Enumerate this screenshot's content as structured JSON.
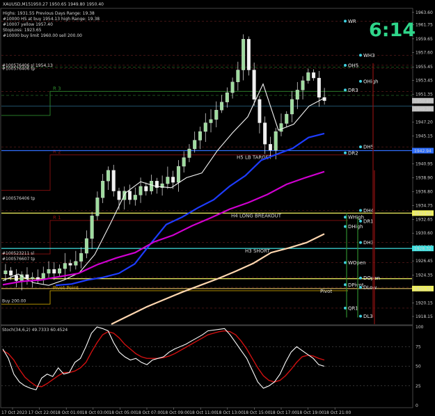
{
  "header": {
    "symbol": "XAUUSD,M15",
    "ohlc": "1950.27 1950.65 1949.80 1950.40",
    "info_lines": [
      "Highs: 1931.55   Previous Days Range: 19.38",
      "#10000 HS at buy 1954.13 high Range: 19.38",
      "#10007 yellow 1957.40",
      "StopLoss: 1923.65",
      "#10000 buy limit 1960.00  sell 200.00"
    ]
  },
  "clock": "6:14",
  "colors": {
    "background": "#000000",
    "candle": "#f0f0f0",
    "ma_fast": "#f5f5f5",
    "ma_blue": "#1e3cff",
    "ma_magenta": "#d000d0",
    "ma_tan": "#ffd7b0",
    "stoch_main": "#ffffff",
    "stoch_signal": "#d01010",
    "yellow_level": "#f0f060",
    "cyan_level": "#40e0e0",
    "blue_level": "#3070ff",
    "dark_red": "#8b1010",
    "green_level": "#2e8b2e"
  },
  "price_axis": {
    "min": 1917,
    "max": 1964,
    "ticks": [
      "1963.60",
      "1961.75",
      "1959.65",
      "1957.60",
      "1955.45",
      "1953.45",
      "1951.35",
      "1949.20",
      "1947.20",
      "1945.15",
      "1942.95",
      "1940.95",
      "1938.90",
      "1936.80",
      "1934.75",
      "1932.65",
      "1930.60",
      "1928.55",
      "1926.45",
      "1924.35",
      "1922.30",
      "1920.15",
      "1918.15"
    ],
    "tags": [
      {
        "text": "1950.40",
        "price": 1950.4,
        "color": "#c0c0c0"
      },
      {
        "text": "1949.20",
        "price": 1949.2,
        "color": "#c0c0c0"
      },
      {
        "text": "1942.94",
        "price": 1942.94,
        "color": "#3070ff"
      },
      {
        "text": "1933.60",
        "price": 1933.6,
        "color": "#f0f060"
      },
      {
        "text": "1928.32",
        "price": 1928.32,
        "color": "#40e0e0"
      },
      {
        "text": "1922.32",
        "price": 1922.32,
        "color": "#f0f060"
      }
    ]
  },
  "time_axis": {
    "labels": [
      "17 Oct 2023",
      "17 Oct 22:00",
      "18 Oct 01:00",
      "18 Oct 03:00",
      "18 Oct 05:00",
      "18 Oct 07:00",
      "18 Oct 09:00",
      "18 Oct 11:00",
      "18 Oct 13:00",
      "18 Oct 15:00",
      "18 Oct 17:00",
      "18 Oct 19:00",
      "18 Oct 21:00"
    ]
  },
  "levels": [
    {
      "label": "R 3",
      "price": 1951.8,
      "color": "#2e8b2e"
    },
    {
      "label": "R 2",
      "price": 1942.3,
      "color": "#8b1010"
    },
    {
      "label": "R 1",
      "price": 1932.5,
      "color": "#8b1010"
    },
    {
      "label": "Pivot Point",
      "price": 1922.0,
      "color": "#c8a000"
    },
    {
      "label": "H5 LB TARGET",
      "price": 1942.3,
      "color": "#d8d8d8"
    },
    {
      "label": "H4 LONG BREAKOUT",
      "price": 1933.6,
      "color": "#d8d8d8"
    },
    {
      "label": "H3 SHORT",
      "price": 1928.32,
      "color": "#d8d8d8"
    },
    {
      "label": "Pivot",
      "price": 1922.3,
      "color": "#d8d8d8"
    }
  ],
  "right_labels": [
    {
      "text": "WR",
      "price": 1962.3
    },
    {
      "text": "WH3",
      "price": 1957.2
    },
    {
      "text": "OH5",
      "price": 1955.7
    },
    {
      "text": "OHigh",
      "price": 1953.3
    },
    {
      "text": "DR3",
      "price": 1952.0
    },
    {
      "text": "DH5",
      "price": 1943.5
    },
    {
      "text": "DR2",
      "price": 1942.6
    },
    {
      "text": "DH4",
      "price": 1934.0
    },
    {
      "text": "WHigh",
      "price": 1933.0
    },
    {
      "text": "DR1",
      "price": 1932.4
    },
    {
      "text": "DHigh",
      "price": 1931.6
    },
    {
      "text": "DH3",
      "price": 1929.2
    },
    {
      "text": "WOpen",
      "price": 1926.2
    },
    {
      "text": "DOpen",
      "price": 1923.9
    },
    {
      "text": "DPivot",
      "price": 1922.9
    },
    {
      "text": "DLow",
      "price": 1922.5
    },
    {
      "text": "QR1",
      "price": 1919.4
    },
    {
      "text": "DL3",
      "price": 1918.2
    }
  ],
  "order_labels": [
    {
      "text": "#100576406 tp",
      "price": 1935.8
    },
    {
      "text": "#100523211 sl",
      "price": 1927.6
    },
    {
      "text": "#100576607 tp",
      "price": 1926.8
    },
    {
      "text": "#100576406 sl  1954.13",
      "price": 1955.7
    },
    {
      "text": "#100576406 tp",
      "price": 1955.2
    },
    {
      "text": "Buy 200.00",
      "price": 1920.5
    }
  ],
  "stochastic": {
    "title": "Stoch(34,6,2) 49.7333 60.4524",
    "ticks": [
      "100",
      "75",
      "50",
      "25",
      "0"
    ],
    "min": 0,
    "max": 100
  },
  "chart_data": {
    "type": "line",
    "title": "XAUUSD,M15",
    "xlabel": "",
    "ylabel": "",
    "ylim": [
      1917,
      1964
    ],
    "candles_close_approx": [
      1925.0,
      1924.3,
      1923.5,
      1924.4,
      1923.8,
      1924.0,
      1923.6,
      1924.6,
      1925.2,
      1924.6,
      1925.3,
      1926.1,
      1925.8,
      1926.4,
      1927.6,
      1929.8,
      1933.2,
      1935.9,
      1938.4,
      1940.0,
      1936.9,
      1935.6,
      1936.9,
      1935.6,
      1936.3,
      1937.6,
      1936.9,
      1938.4,
      1937.4,
      1938.0,
      1939.0,
      1938.2,
      1940.6,
      1941.9,
      1943.2,
      1944.5,
      1945.8,
      1947.1,
      1947.6,
      1949.0,
      1950.2,
      1951.6,
      1953.2,
      1955.0,
      1959.6,
      1955.0,
      1950.6,
      1947.1,
      1943.9,
      1943.0,
      1945.8,
      1947.0,
      1948.4,
      1950.6,
      1952.0,
      1953.4,
      1954.6,
      1953.8,
      1950.9,
      1950.4
    ],
    "series": [
      {
        "name": "",
        "values": [
          1923.5,
          1924.5,
          1923.2,
          1922.8,
          1923.6,
          1924.7,
          1927.4,
          1931.9,
          1936.6,
          1938.3,
          1937.6,
          1937.4,
          1938.9,
          1939.6,
          1942.9,
          1945.6,
          1948.0,
          1952.9,
          1946.0,
          1946.9,
          1949.6,
          1950.8
        ]
      },
      {
        "name": "",
        "values": [
          1922.8,
          1923.0,
          1923.6,
          1924.0,
          1924.6,
          1926.0,
          1929.0,
          1931.9,
          1933.0,
          1934.4,
          1935.6,
          1937.6,
          1939.2,
          1941.5,
          1942.4,
          1943.3,
          1944.9,
          1945.5
        ]
      },
      {
        "name": "",
        "values": [
          1922.9,
          1923.4,
          1923.6,
          1924.1,
          1924.6,
          1925.9,
          1926.9,
          1927.7,
          1929.3,
          1930.3,
          1931.7,
          1932.9,
          1934.2,
          1935.2,
          1936.4,
          1937.9,
          1938.9,
          1939.8
        ]
      },
      {
        "name": "",
        "values": [
          1917.0,
          1918.3,
          1919.6,
          1920.7,
          1921.8,
          1922.8,
          1923.8,
          1924.9,
          1926.1,
          1927.7,
          1928.4,
          1929.2,
          1930.5
        ]
      }
    ]
  }
}
